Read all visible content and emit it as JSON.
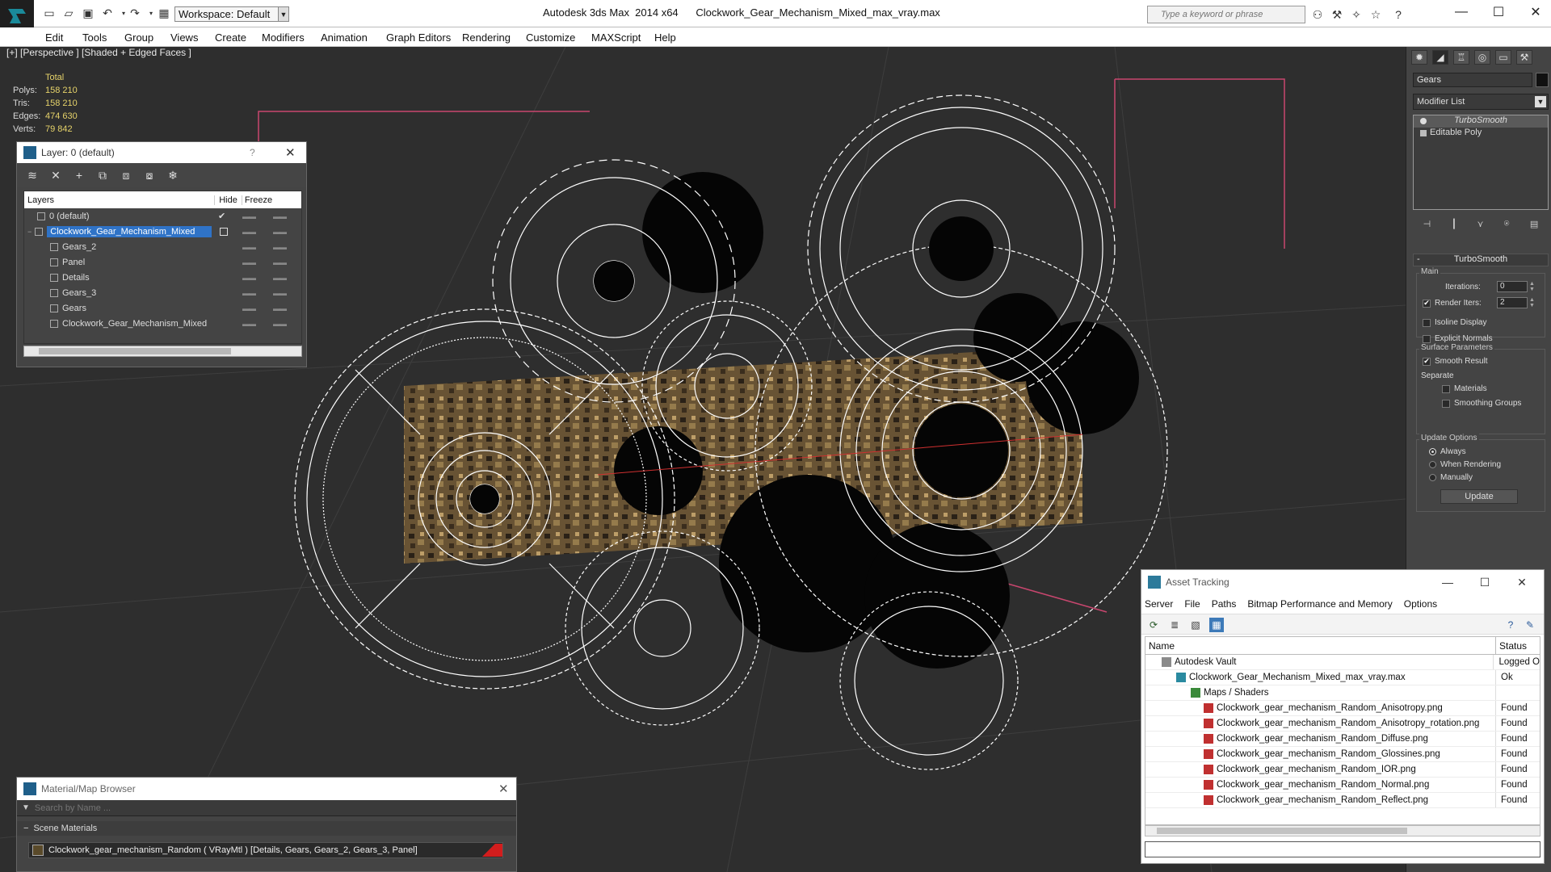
{
  "titlebar": {
    "workspace": "Workspace: Default",
    "title": "Autodesk 3ds Max  2014 x64      Clockwork_Gear_Mechanism_Mixed_max_vray.max",
    "search_placeholder": "Type a keyword or phrase"
  },
  "menu": [
    "Edit",
    "Tools",
    "Group",
    "Views",
    "Create",
    "Modifiers",
    "Animation",
    "Graph Editors",
    "Rendering",
    "Customize",
    "MAXScript",
    "Help"
  ],
  "viewport": {
    "label": "[+] [Perspective ] [Shaded + Edged Faces ]",
    "stats": {
      "total_label": "Total",
      "rows": [
        {
          "key": "Polys:",
          "val": "158 210"
        },
        {
          "key": "Tris:",
          "val": "158 210"
        },
        {
          "key": "Edges:",
          "val": "474 630"
        },
        {
          "key": "Verts:",
          "val": "79 842"
        }
      ]
    }
  },
  "layer_window": {
    "title": "Layer: 0 (default)",
    "help": "?",
    "headers": {
      "layers": "Layers",
      "hide": "Hide",
      "freeze": "Freeze"
    },
    "rows": [
      {
        "name": "0 (default)",
        "indent": 0
      },
      {
        "name": "Clockwork_Gear_Mechanism_Mixed",
        "indent": 0,
        "selected": true
      },
      {
        "name": "Gears_2",
        "indent": 1
      },
      {
        "name": "Panel",
        "indent": 1
      },
      {
        "name": "Details",
        "indent": 1
      },
      {
        "name": "Gears_3",
        "indent": 1
      },
      {
        "name": "Gears",
        "indent": 1
      },
      {
        "name": "Clockwork_Gear_Mechanism_Mixed",
        "indent": 1
      }
    ],
    "check": "✔"
  },
  "command_panel": {
    "object_name": "Gears",
    "modifier_list": "Modifier List",
    "stack": [
      "TurboSmooth",
      "Editable Poly"
    ],
    "rollout_title": "TurboSmooth",
    "main_label": "Main",
    "iterations_label": "Iterations:",
    "iterations_val": "0",
    "render_iters_label": "Render Iters:",
    "render_iters_val": "2",
    "isoline": "Isoline Display",
    "explicit": "Explicit Normals",
    "surface_label": "Surface Parameters",
    "smooth_result": "Smooth Result",
    "separate_label": "Separate",
    "materials": "Materials",
    "smoothing_groups": "Smoothing Groups",
    "update_options_label": "Update Options",
    "always": "Always",
    "when_rendering": "When Rendering",
    "manually": "Manually",
    "update_btn": "Update",
    "minus": "-"
  },
  "asset_window": {
    "title": "Asset Tracking",
    "menu": [
      "Server",
      "File",
      "Paths",
      "Bitmap Performance and Memory",
      "Options"
    ],
    "headers": {
      "name": "Name",
      "status": "Status"
    },
    "rows": [
      {
        "name": "Autodesk Vault",
        "status": "Logged O",
        "indent": 1,
        "icon": "vault"
      },
      {
        "name": "Clockwork_Gear_Mechanism_Mixed_max_vray.max",
        "status": "Ok",
        "indent": 2,
        "icon": "max"
      },
      {
        "name": "Maps / Shaders",
        "status": "",
        "indent": 3,
        "icon": "folder"
      },
      {
        "name": "Clockwork_gear_mechanism_Random_Anisotropy.png",
        "status": "Found",
        "indent": 4,
        "icon": "png"
      },
      {
        "name": "Clockwork_gear_mechanism_Random_Anisotropy_rotation.png",
        "status": "Found",
        "indent": 4,
        "icon": "png"
      },
      {
        "name": "Clockwork_gear_mechanism_Random_Diffuse.png",
        "status": "Found",
        "indent": 4,
        "icon": "png"
      },
      {
        "name": "Clockwork_gear_mechanism_Random_Glossines.png",
        "status": "Found",
        "indent": 4,
        "icon": "png"
      },
      {
        "name": "Clockwork_gear_mechanism_Random_IOR.png",
        "status": "Found",
        "indent": 4,
        "icon": "png"
      },
      {
        "name": "Clockwork_gear_mechanism_Random_Normal.png",
        "status": "Found",
        "indent": 4,
        "icon": "png"
      },
      {
        "name": "Clockwork_gear_mechanism_Random_Reflect.png",
        "status": "Found",
        "indent": 4,
        "icon": "png"
      }
    ]
  },
  "material_window": {
    "title": "Material/Map Browser",
    "search_placeholder": "Search by Name ...",
    "section": "Scene Materials",
    "material": "Clockwork_gear_mechanism_Random  ( VRayMtl )  [Details, Gears, Gears_2, Gears_3, Panel]"
  },
  "colors": {
    "accent": "#2f73c7",
    "stat_value": "#e6d36a",
    "bounding_box": "#c8466e",
    "gear_wire": "#ffffff",
    "panel": "#7a6238"
  }
}
